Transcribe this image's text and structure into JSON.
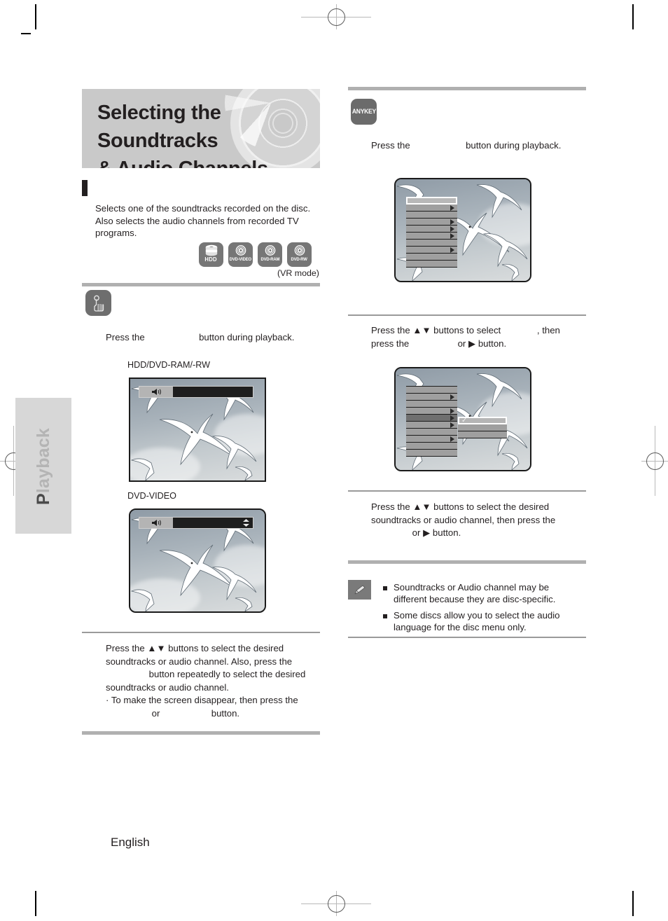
{
  "page": {
    "language_footer": "English",
    "side_tab": {
      "first_letter": "P",
      "rest": "layback",
      "full": "Playback"
    }
  },
  "title": {
    "line1": "Selecting the Soundtracks",
    "line2": "& Audio Channels"
  },
  "intro": {
    "text": "Selects one of the soundtracks recorded on the disc. Also selects the audio channels from recorded TV programs."
  },
  "disc_icons": {
    "items": [
      {
        "name": "HDD",
        "icon": "hdd-stack-icon"
      },
      {
        "name": "DVD-VIDEO",
        "icon": "disc-icon"
      },
      {
        "name": "DVD-RAM",
        "icon": "disc-icon"
      },
      {
        "name": "DVD-RW",
        "icon": "disc-icon"
      }
    ],
    "note": "(VR mode)"
  },
  "left_column": {
    "step1": {
      "badge_icon": "finger-press-icon",
      "text_before": "Press the",
      "text_after": "button during playback."
    },
    "screens": [
      {
        "label": "HDD/DVD-RAM/-RW",
        "osd_icon": "speaker-icon",
        "has_updown": false
      },
      {
        "label": "DVD-VIDEO",
        "osd_icon": "speaker-icon",
        "has_updown": true
      }
    ],
    "instruction": {
      "line1_a": "Press the",
      "line1_arrows": "▲▼",
      "line1_b": "buttons to select the desired",
      "line2": "soundtracks or audio channel. Also, press the",
      "line3_a": "",
      "line3_b": "button repeatedly to select the desired",
      "line4": "soundtracks or audio channel.",
      "bullet_line1": "· To make the screen disappear, then press the",
      "bullet_line2_or": "or",
      "bullet_line2_b": "button."
    }
  },
  "right_column": {
    "step1": {
      "badge_label": "ANYKEY",
      "text_before": "Press the",
      "text_after": "button during playback."
    },
    "menu_screen_1": {
      "rows": 10,
      "highlighted_row": 1,
      "rows_with_arrow": [
        2,
        4,
        5,
        6,
        8
      ]
    },
    "instruction_1": {
      "line1_a": "Press the",
      "line1_arrows": "▲▼",
      "line1_b": "buttons to select",
      "line1_c": ", then",
      "line2_a": "press the",
      "line2_or": "or",
      "line2_arrow": "▶",
      "line2_b": "button."
    },
    "menu_screen_2": {
      "rows": 10,
      "active_row": 5,
      "rows_with_arrow": [
        2,
        4,
        5,
        6,
        8
      ],
      "submenu_rows": 3,
      "submenu_selected_row": 1,
      "submenu_check": "✓"
    },
    "instruction_2": {
      "line1_a": "Press the",
      "line1_arrows": "▲▼",
      "line1_b": "buttons to select the desired",
      "line2": "soundtracks or audio channel, then press the",
      "line3_or": "or",
      "line3_arrow": "▶",
      "line3_b": "button."
    },
    "note": {
      "icon": "pencil-note-icon",
      "items": [
        "Soundtracks or Audio channel may be different because they are disc-specific.",
        "Some discs allow you to select the audio language for the disc menu only."
      ]
    }
  }
}
